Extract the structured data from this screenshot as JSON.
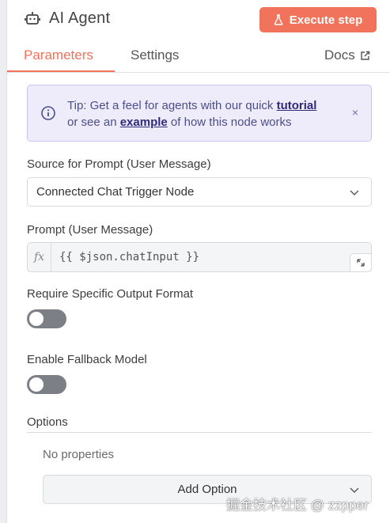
{
  "header": {
    "title": "AI Agent",
    "icon": "robot-icon",
    "execute_label": "Execute step",
    "execute_icon": "flask-icon",
    "accent_color": "#f2735c"
  },
  "tabs": {
    "parameters": "Parameters",
    "settings": "Settings",
    "docs": "Docs",
    "active": "Parameters"
  },
  "tip": {
    "prefix": "Tip: Get a feel for agents with our quick ",
    "link1": "tutorial",
    "middle": "or see an ",
    "link2": "example",
    "suffix": " of how this node works",
    "close": "×"
  },
  "source": {
    "label": "Source for Prompt (User Message)",
    "value": "Connected Chat Trigger Node"
  },
  "prompt": {
    "label": "Prompt (User Message)",
    "fx": "fx",
    "expression": "{{ $json.chatInput }}"
  },
  "output_format": {
    "label": "Require Specific Output Format",
    "enabled": false
  },
  "fallback": {
    "label": "Enable Fallback Model",
    "enabled": false
  },
  "options": {
    "title": "Options",
    "empty_text": "No properties",
    "add_label": "Add Option"
  },
  "watermark": "掘金技术社区 @ zzpper"
}
